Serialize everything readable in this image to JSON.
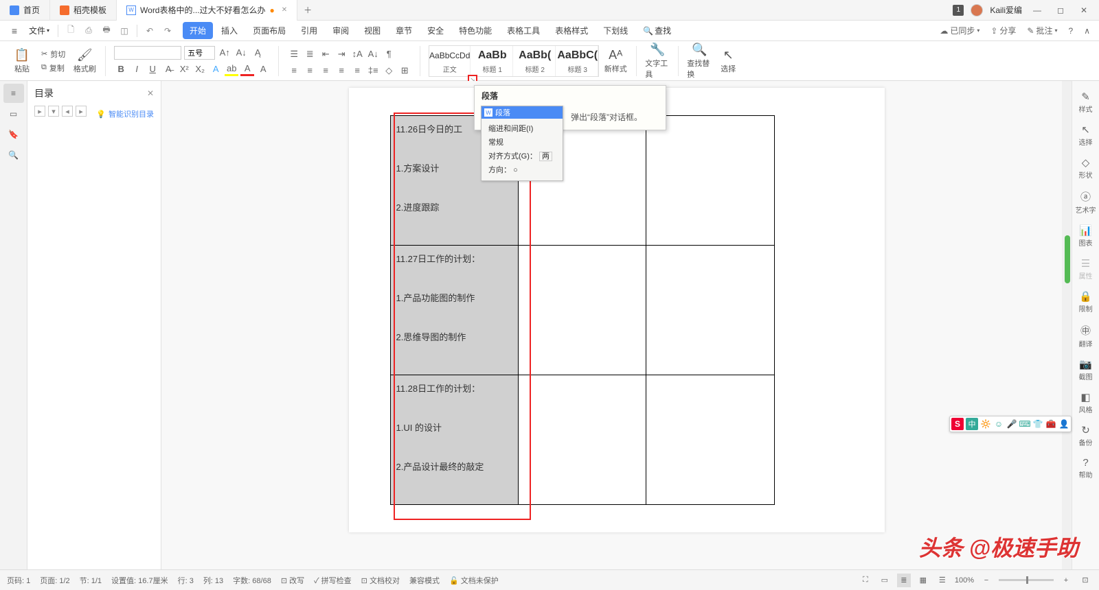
{
  "titlebar": {
    "tabs": [
      {
        "label": "首页",
        "icon_color": "#4a8bf5"
      },
      {
        "label": "稻壳模板",
        "icon_color": "#f56c2d"
      },
      {
        "label": "Word表格中的...过大不好看怎么办",
        "icon_color": "#4a8bf5",
        "modified": "●"
      }
    ],
    "username": "Kaili爱编",
    "badge": "1"
  },
  "menubar": {
    "file": "文件",
    "tabs": [
      "开始",
      "插入",
      "页面布局",
      "引用",
      "审阅",
      "视图",
      "章节",
      "安全",
      "特色功能",
      "表格工具",
      "表格样式",
      "下划线"
    ],
    "active_index": 0,
    "search": "查找",
    "sync": "已同步",
    "share": "分享",
    "criticize": "批注"
  },
  "ribbon": {
    "paste": "粘贴",
    "cut": "剪切",
    "copy": "复制",
    "format_painter": "格式刷",
    "font_name": "",
    "font_size": "五号",
    "styles": [
      {
        "preview": "AaBbCcDd",
        "label": "正文",
        "big": false
      },
      {
        "preview": "AaBb",
        "label": "标题 1",
        "big": true
      },
      {
        "preview": "AaBb(",
        "label": "标题 2",
        "big": true
      },
      {
        "preview": "AaBbC(",
        "label": "标题 3",
        "big": true
      }
    ],
    "new_style": "新样式",
    "text_tools": "文字工具",
    "find_replace": "查找替换",
    "select": "选择"
  },
  "toc": {
    "title": "目录",
    "smart": "智能识别目录"
  },
  "document": {
    "cells": [
      [
        "11.26日今日的工",
        "1.方案设计",
        "2.进度跟踪"
      ],
      [
        "11.27日工作的计划：",
        "1.产品功能图的制作",
        "2.思维导图的制作"
      ],
      [
        "11.28日工作的计划：",
        "1.UI 的设计",
        "2.产品设计最终的敲定"
      ]
    ]
  },
  "tooltip": {
    "title": "段落",
    "desc": "弹出“段落”对话框。"
  },
  "dialog": {
    "caption": "段落",
    "tab": "缩进和间距(I)",
    "section": "常规",
    "align_label": "对齐方式(G)：",
    "align_value": "两",
    "direction": "方向："
  },
  "right_tools": [
    "样式",
    "选择",
    "形状",
    "艺术字",
    "图表",
    "属性",
    "限制",
    "翻译",
    "截图",
    "风格",
    "备份",
    "帮助"
  ],
  "statusbar": {
    "page": "页码: 1",
    "pages": "页面: 1/2",
    "section": "节: 1/1",
    "setting": "设置值: 16.7厘米",
    "row": "行: 3",
    "col": "列: 13",
    "words": "字数: 68/68",
    "revise": "改写",
    "spell": "拼写检查",
    "proof": "文档校对",
    "compat": "兼容模式",
    "unprotected": "文档未保护",
    "zoom": "100%"
  },
  "watermark": "头条 @极速手助"
}
